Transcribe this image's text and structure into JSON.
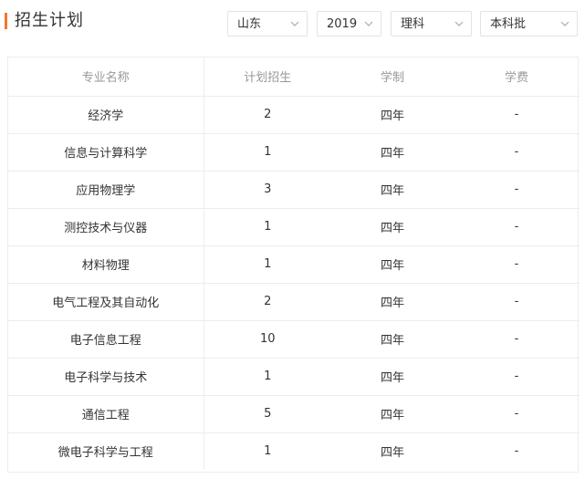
{
  "header": {
    "title": "招生计划",
    "accent_color": "#f07a2b"
  },
  "filters": [
    {
      "value": "山东",
      "icon": "chevron-down-icon"
    },
    {
      "value": "2019",
      "icon": "chevron-down-icon"
    },
    {
      "value": "理科",
      "icon": "chevron-down-icon"
    },
    {
      "value": "本科批",
      "icon": "chevron-down-icon"
    }
  ],
  "table": {
    "columns": [
      "专业名称",
      "计划招生",
      "学制",
      "学费"
    ],
    "rows": [
      [
        "经济学",
        "2",
        "四年",
        "-"
      ],
      [
        "信息与计算科学",
        "1",
        "四年",
        "-"
      ],
      [
        "应用物理学",
        "3",
        "四年",
        "-"
      ],
      [
        "测控技术与仪器",
        "1",
        "四年",
        "-"
      ],
      [
        "材料物理",
        "1",
        "四年",
        "-"
      ],
      [
        "电气工程及其自动化",
        "2",
        "四年",
        "-"
      ],
      [
        "电子信息工程",
        "10",
        "四年",
        "-"
      ],
      [
        "电子科学与技术",
        "1",
        "四年",
        "-"
      ],
      [
        "通信工程",
        "5",
        "四年",
        "-"
      ],
      [
        "微电子科学与工程",
        "1",
        "四年",
        "-"
      ]
    ]
  }
}
